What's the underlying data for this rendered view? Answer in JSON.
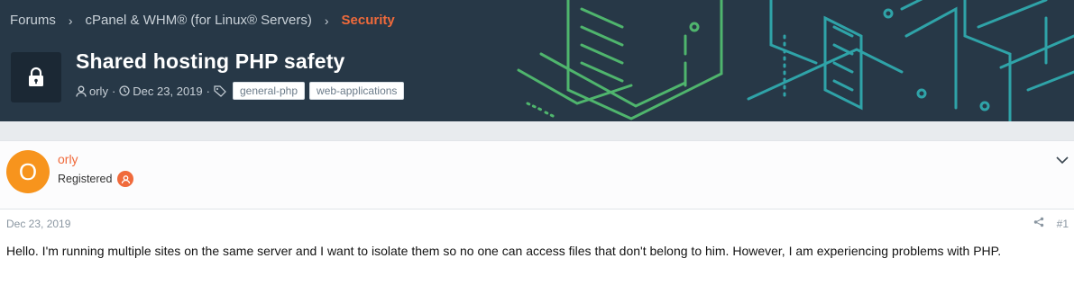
{
  "breadcrumb": {
    "items": [
      "Forums",
      "cPanel & WHM® (for Linux® Servers)"
    ],
    "current": "Security"
  },
  "thread": {
    "title": "Shared hosting PHP safety",
    "author": "orly",
    "date": "Dec 23, 2019",
    "tags": [
      "general-php",
      "web-applications"
    ]
  },
  "post": {
    "avatar_letter": "O",
    "username": "orly",
    "role": "Registered",
    "date": "Dec 23, 2019",
    "number": "#1",
    "body": "Hello. I'm running multiple sites on the same server and I want to isolate them so no one can access files that don't belong to him. However, I am experiencing problems with PHP."
  },
  "colors": {
    "banner_bg": "#273847",
    "accent": "#f06a3b",
    "avatar_bg": "#f7941d",
    "art_green": "#4fb56d",
    "art_teal": "#2fa3a8"
  },
  "icons": {
    "lock": "lock-icon",
    "user": "user-icon",
    "clock": "clock-icon",
    "tags": "tags-icon",
    "chevron": "chevron-down-icon",
    "share": "share-icon",
    "role": "role-badge-icon"
  }
}
